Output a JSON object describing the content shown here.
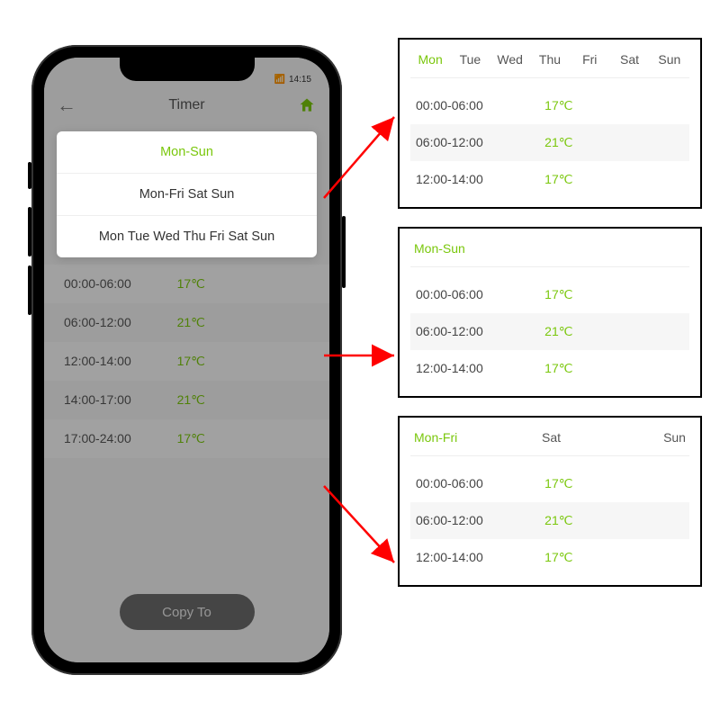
{
  "colors": {
    "accent": "#7ac70c"
  },
  "phone": {
    "status_time": "14:15",
    "header_title": "Timer",
    "popup_options": [
      {
        "label": "Mon-Sun",
        "selected": true
      },
      {
        "label": "Mon-Fri Sat Sun",
        "selected": false
      },
      {
        "label": "Mon Tue Wed Thu Fri Sat Sun",
        "selected": false
      }
    ],
    "schedule": [
      {
        "time": "00:00-06:00",
        "temp": "17℃"
      },
      {
        "time": "06:00-12:00",
        "temp": "21℃"
      },
      {
        "time": "12:00-14:00",
        "temp": "17℃"
      },
      {
        "time": "14:00-17:00",
        "temp": "21℃"
      },
      {
        "time": "17:00-24:00",
        "temp": "17℃"
      }
    ],
    "copy_button": "Copy To"
  },
  "panels": [
    {
      "tabs": [
        {
          "label": "Mon",
          "active": true
        },
        {
          "label": "Tue"
        },
        {
          "label": "Wed"
        },
        {
          "label": "Thu"
        },
        {
          "label": "Fri"
        },
        {
          "label": "Sat"
        },
        {
          "label": "Sun"
        }
      ],
      "rows": [
        {
          "time": "00:00-06:00",
          "temp": "17℃"
        },
        {
          "time": "06:00-12:00",
          "temp": "21℃"
        },
        {
          "time": "12:00-14:00",
          "temp": "17℃"
        }
      ]
    },
    {
      "tabs": [
        {
          "label": "Mon-Sun",
          "active": true
        }
      ],
      "rows": [
        {
          "time": "00:00-06:00",
          "temp": "17℃"
        },
        {
          "time": "06:00-12:00",
          "temp": "21℃"
        },
        {
          "time": "12:00-14:00",
          "temp": "17℃"
        }
      ]
    },
    {
      "tabs": [
        {
          "label": "Mon-Fri",
          "active": true
        },
        {
          "label": "Sat"
        },
        {
          "label": "Sun"
        }
      ],
      "rows": [
        {
          "time": "00:00-06:00",
          "temp": "17℃"
        },
        {
          "time": "06:00-12:00",
          "temp": "21℃"
        },
        {
          "time": "12:00-14:00",
          "temp": "17℃"
        }
      ]
    }
  ]
}
